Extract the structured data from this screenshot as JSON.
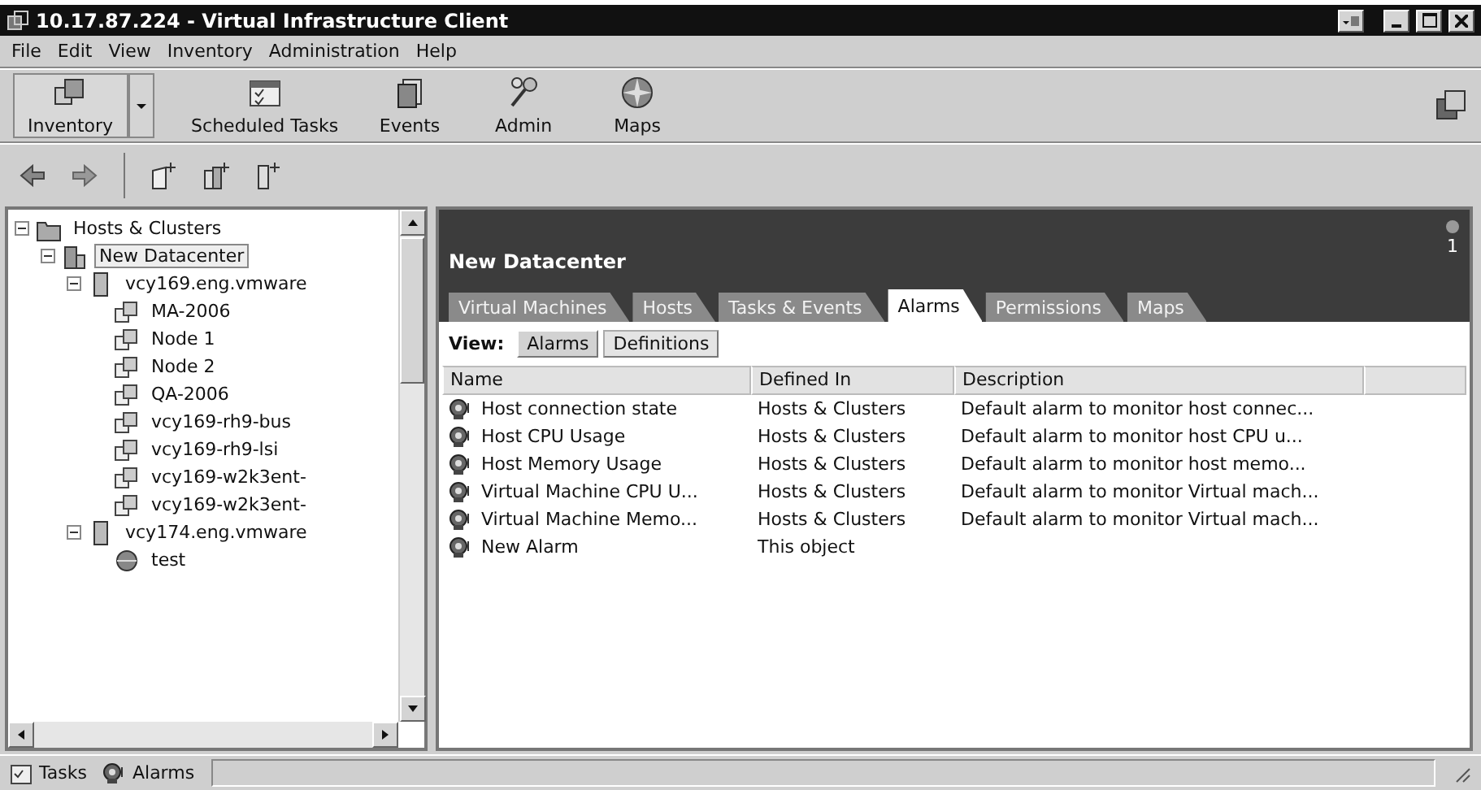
{
  "window": {
    "title": "10.17.87.224 - Virtual Infrastructure Client"
  },
  "menu": [
    "File",
    "Edit",
    "View",
    "Inventory",
    "Administration",
    "Help"
  ],
  "toolbar": [
    {
      "label": "Inventory",
      "kind": "inventory",
      "selected": true
    },
    {
      "label": "Scheduled Tasks",
      "kind": "tasks",
      "selected": false
    },
    {
      "label": "Events",
      "kind": "events",
      "selected": false
    },
    {
      "label": "Admin",
      "kind": "admin",
      "selected": false
    },
    {
      "label": "Maps",
      "kind": "maps",
      "selected": false
    }
  ],
  "tree": [
    {
      "label": "Hosts & Clusters",
      "kind": "folder",
      "expanded": true,
      "selected": false,
      "children": [
        {
          "label": "New Datacenter",
          "kind": "datacenter",
          "expanded": true,
          "selected": true,
          "children": [
            {
              "label": "vcy169.eng.vmware",
              "kind": "host",
              "expanded": true,
              "selected": false,
              "children": [
                {
                  "label": "MA-2006",
                  "kind": "vm",
                  "selected": false
                },
                {
                  "label": "Node 1",
                  "kind": "vm",
                  "selected": false
                },
                {
                  "label": "Node 2",
                  "kind": "vm",
                  "selected": false
                },
                {
                  "label": "QA-2006",
                  "kind": "vm",
                  "selected": false
                },
                {
                  "label": "vcy169-rh9-bus",
                  "kind": "vm",
                  "selected": false
                },
                {
                  "label": "vcy169-rh9-lsi",
                  "kind": "vm",
                  "selected": false
                },
                {
                  "label": "vcy169-w2k3ent-",
                  "kind": "vm",
                  "selected": false
                },
                {
                  "label": "vcy169-w2k3ent-",
                  "kind": "vm",
                  "selected": false
                }
              ]
            },
            {
              "label": "vcy174.eng.vmware",
              "kind": "host",
              "expanded": true,
              "selected": false,
              "children": [
                {
                  "label": "test",
                  "kind": "pool",
                  "selected": false
                }
              ]
            }
          ]
        }
      ]
    }
  ],
  "panel": {
    "title": "New Datacenter",
    "alarm_count": "1",
    "tabs": [
      {
        "label": "Virtual Machines",
        "selected": false
      },
      {
        "label": "Hosts",
        "selected": false
      },
      {
        "label": "Tasks & Events",
        "selected": false
      },
      {
        "label": "Alarms",
        "selected": true
      },
      {
        "label": "Permissions",
        "selected": false
      },
      {
        "label": "Maps",
        "selected": false
      }
    ],
    "view_label": "View:",
    "view_buttons": [
      {
        "label": "Alarms",
        "selected": false
      },
      {
        "label": "Definitions",
        "selected": true
      }
    ],
    "table": {
      "columns": [
        "Name",
        "Defined In",
        "Description"
      ],
      "rows": [
        [
          "Host connection state",
          "Hosts & Clusters",
          "Default alarm to monitor host connec..."
        ],
        [
          "Host CPU Usage",
          "Hosts & Clusters",
          "Default alarm to monitor host CPU u..."
        ],
        [
          "Host Memory Usage",
          "Hosts & Clusters",
          "Default alarm to monitor host memo..."
        ],
        [
          "Virtual Machine CPU U...",
          "Hosts & Clusters",
          "Default alarm to monitor Virtual mach..."
        ],
        [
          "Virtual Machine Memo...",
          "Hosts & Clusters",
          "Default alarm to monitor Virtual mach..."
        ],
        [
          "New Alarm",
          "This object"
        ]
      ]
    }
  },
  "status_bar": [
    {
      "label": "Tasks",
      "kind": "tasks"
    },
    {
      "label": "Alarms",
      "kind": "alarms"
    }
  ]
}
